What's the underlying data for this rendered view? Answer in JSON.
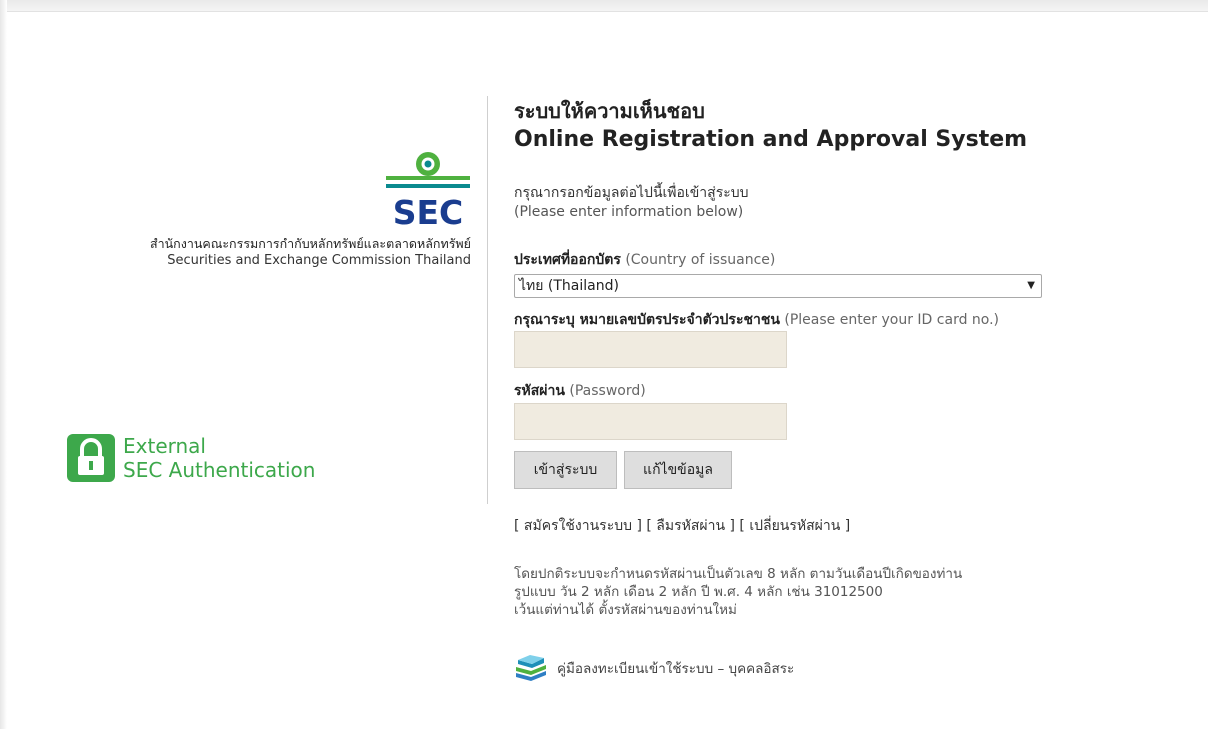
{
  "agency": {
    "logo_text": "SEC",
    "name_th": "สำนักงานคณะกรรมการกำกับหลักทรัพย์และตลาดหลักทรัพย์",
    "name_en": "Securities and Exchange Commission Thailand"
  },
  "external_auth": {
    "line1": "External",
    "line2": "SEC Authentication"
  },
  "title": {
    "th": "ระบบให้ความเห็นชอบ",
    "en": "Online Registration and Approval System"
  },
  "instructions": {
    "th": "กรุณากรอกข้อมูลต่อไปนี้เพื่อเข้าสู่ระบบ",
    "en": "(Please enter information below)"
  },
  "form": {
    "country_label_th": "ประเทศที่ออกบัตร",
    "country_label_en": "(Country of issuance)",
    "country_value": "ไทย (Thailand)",
    "id_label_th": "กรุณาระบุ หมายเลขบัตรประจำตัวประชาชน",
    "id_label_en": "(Please enter your ID card no.)",
    "id_value": "",
    "password_label_th": "รหัสผ่าน",
    "password_label_en": "(Password)",
    "password_value": "",
    "login_button": "เข้าสู่ระบบ",
    "edit_button": "แก้ไขข้อมูล"
  },
  "links": {
    "register": "สมัครใช้งานระบบ",
    "forgot": "ลืมรหัสผ่าน",
    "change": "เปลี่ยนรหัสผ่าน"
  },
  "note": {
    "line1": "โดยปกติระบบจะกำหนดรหัสผ่านเป็นตัวเลข 8 หลัก ตามวันเดือนปีเกิดของท่าน",
    "line2": "รูปแบบ วัน 2 หลัก เดือน 2 หลัก ปี พ.ศ. 4 หลัก เช่น 31012500",
    "line3": "เว้นแต่ท่านได้ ตั้งรหัสผ่านของท่านใหม่"
  },
  "manual": {
    "label": "คู่มือลงทะเบียนเข้าใช้ระบบ – บุคคลอิสระ"
  },
  "colors": {
    "sec_green": "#4fb13f",
    "sec_teal": "#0a8a8f",
    "sec_navy": "#1a3d8f",
    "auth_green": "#3da84b",
    "input_bg": "#f0ebe0"
  }
}
